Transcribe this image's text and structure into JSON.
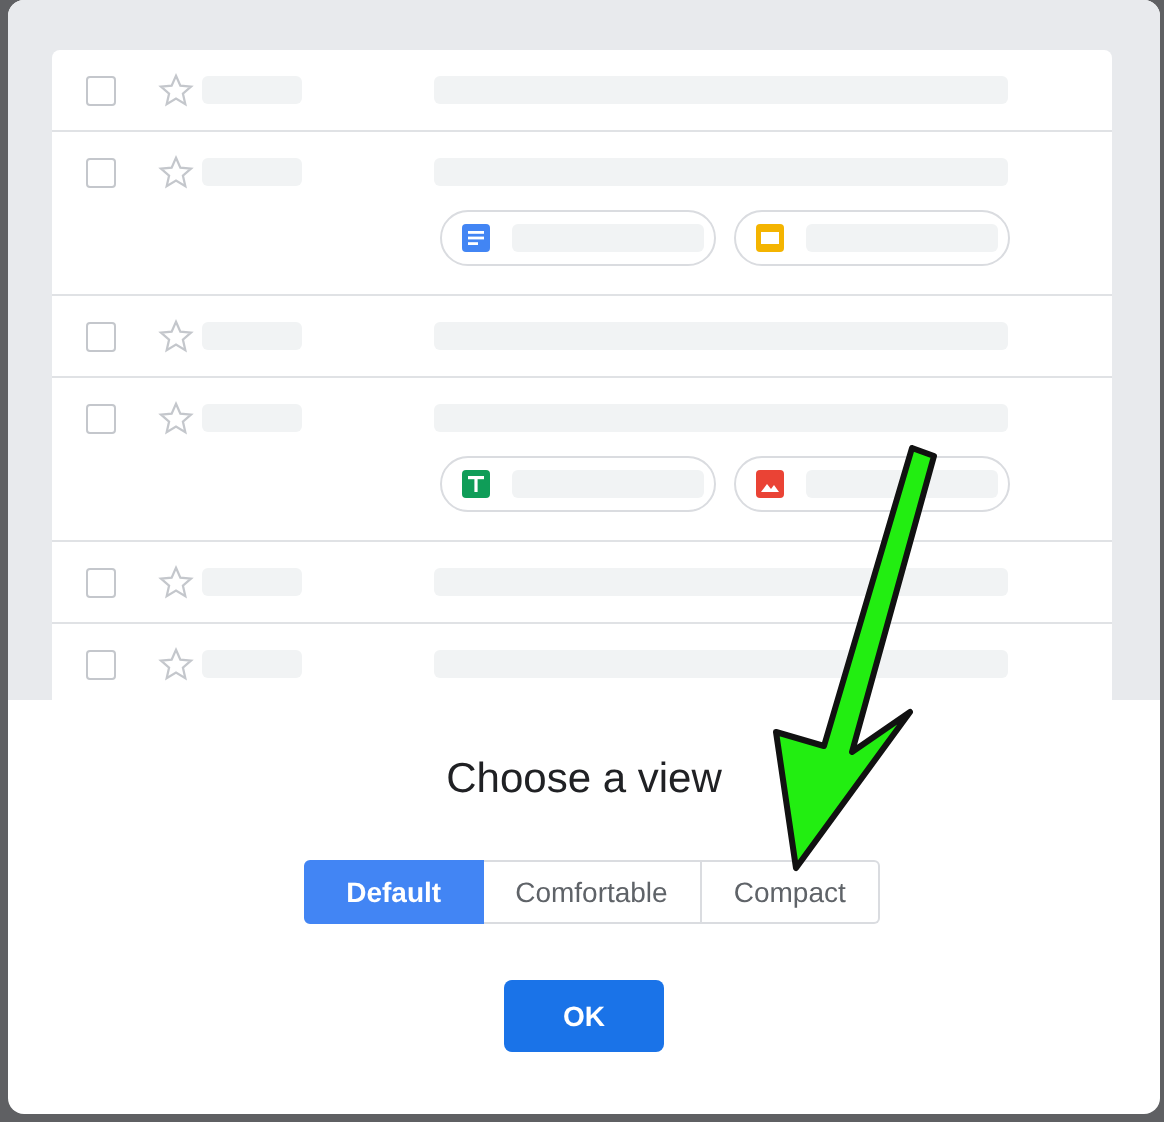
{
  "preview_rows": [
    {
      "kind": "plain",
      "checked": false,
      "starred": false
    },
    {
      "kind": "attachments",
      "checked": false,
      "starred": false,
      "attachments": [
        {
          "kind": "doc"
        },
        {
          "kind": "slides"
        }
      ]
    },
    {
      "kind": "plain",
      "checked": false,
      "starred": false
    },
    {
      "kind": "attachments",
      "checked": false,
      "starred": false,
      "attachments": [
        {
          "kind": "sheet"
        },
        {
          "kind": "image"
        }
      ]
    },
    {
      "kind": "plain",
      "checked": false,
      "starred": false
    },
    {
      "kind": "plain",
      "checked": false,
      "starred": false
    }
  ],
  "dialog": {
    "title": "Choose a view",
    "view_options": [
      {
        "label": "Default",
        "selected": true
      },
      {
        "label": "Comfortable",
        "selected": false
      },
      {
        "label": "Compact",
        "selected": false
      }
    ],
    "ok_button": "OK"
  },
  "annotation": {
    "kind": "arrow"
  }
}
